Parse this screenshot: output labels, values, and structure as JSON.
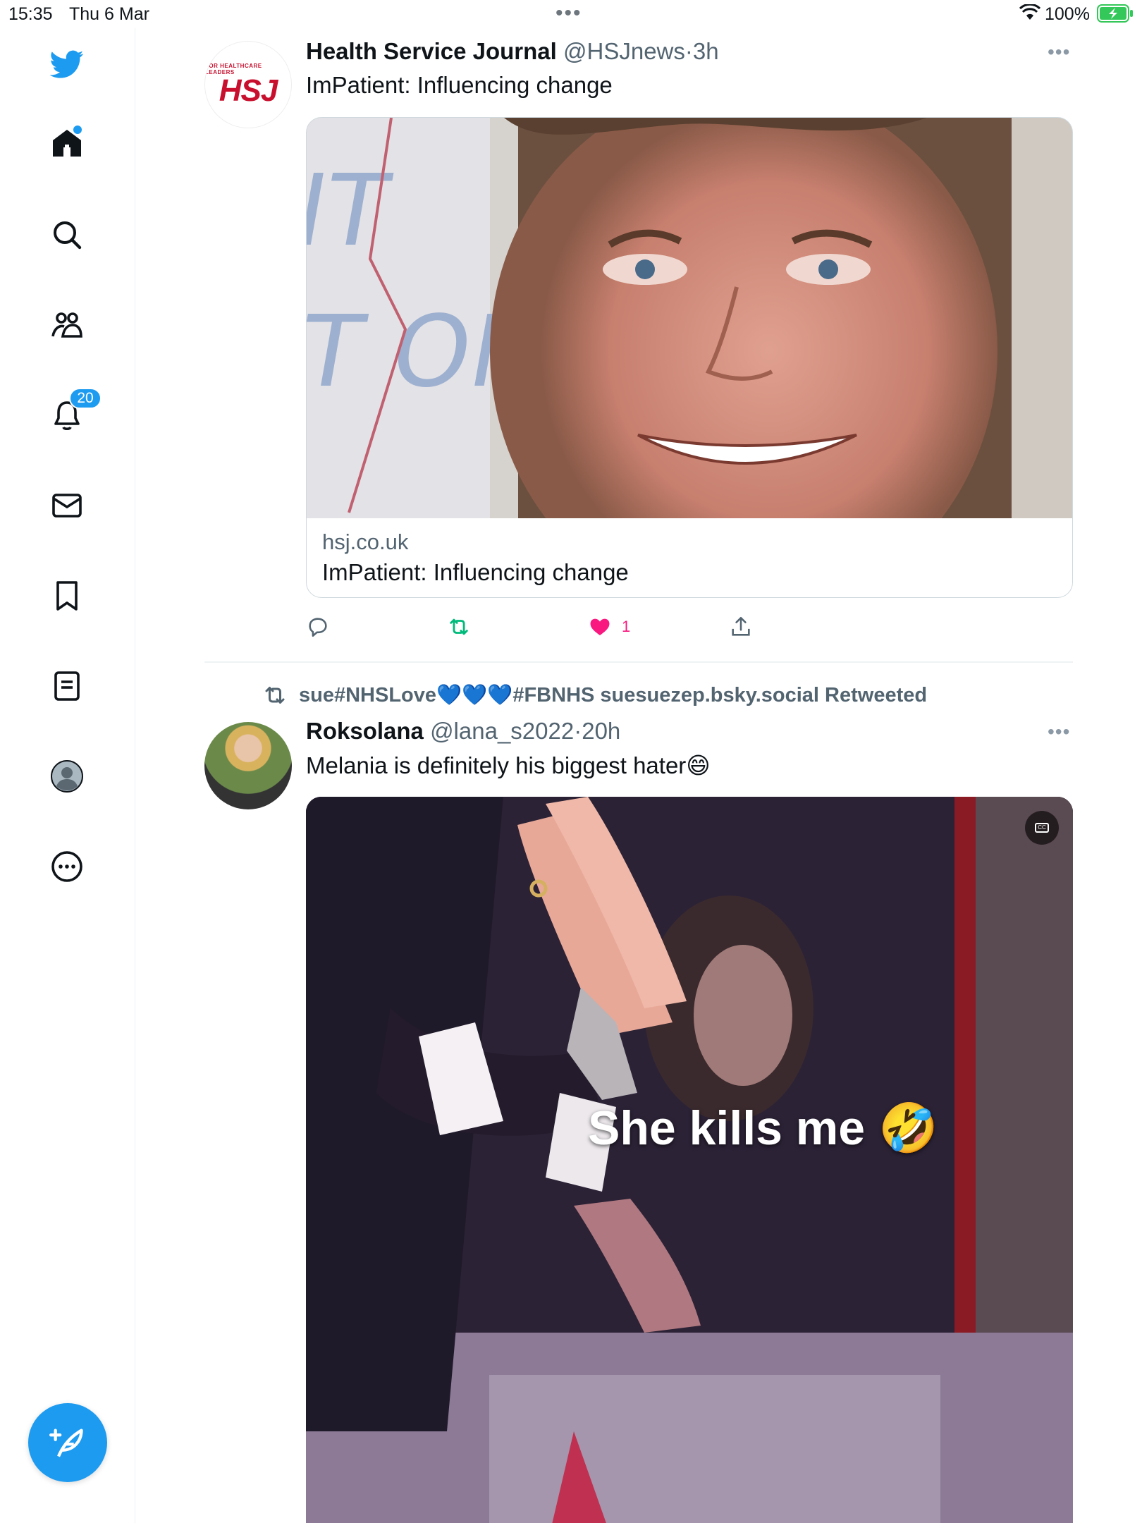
{
  "status_bar": {
    "time": "15:35",
    "date": "Thu 6 Mar",
    "battery": "100%"
  },
  "sidebar": {
    "notification_count": "20"
  },
  "tweets": [
    {
      "name": "Health Service Journal",
      "handle": "@HSJnews",
      "separator": "·",
      "age": "3h",
      "text": "ImPatient: Influencing change",
      "avatar_text_small": "FOR HEALTHCARE LEADERS",
      "avatar_text_big": "HSJ",
      "card": {
        "domain": "hsj.co.uk",
        "title": "ImPatient: Influencing change"
      },
      "likes": "1",
      "retweeted": true,
      "liked": true
    },
    {
      "retweet_by": "sue#NHSLove💙💙💙#FBNHS suesuezep.bsky.social Retweeted",
      "name": "Roksolana",
      "handle": "@lana_s2022",
      "separator": "·",
      "age": "20h",
      "text": "Melania is definitely his biggest hater😄",
      "video_caption": "She kills me 🤣"
    }
  ],
  "colors": {
    "accent": "#1d9bf0",
    "retweet": "#00ba7c",
    "like": "#f91880"
  }
}
